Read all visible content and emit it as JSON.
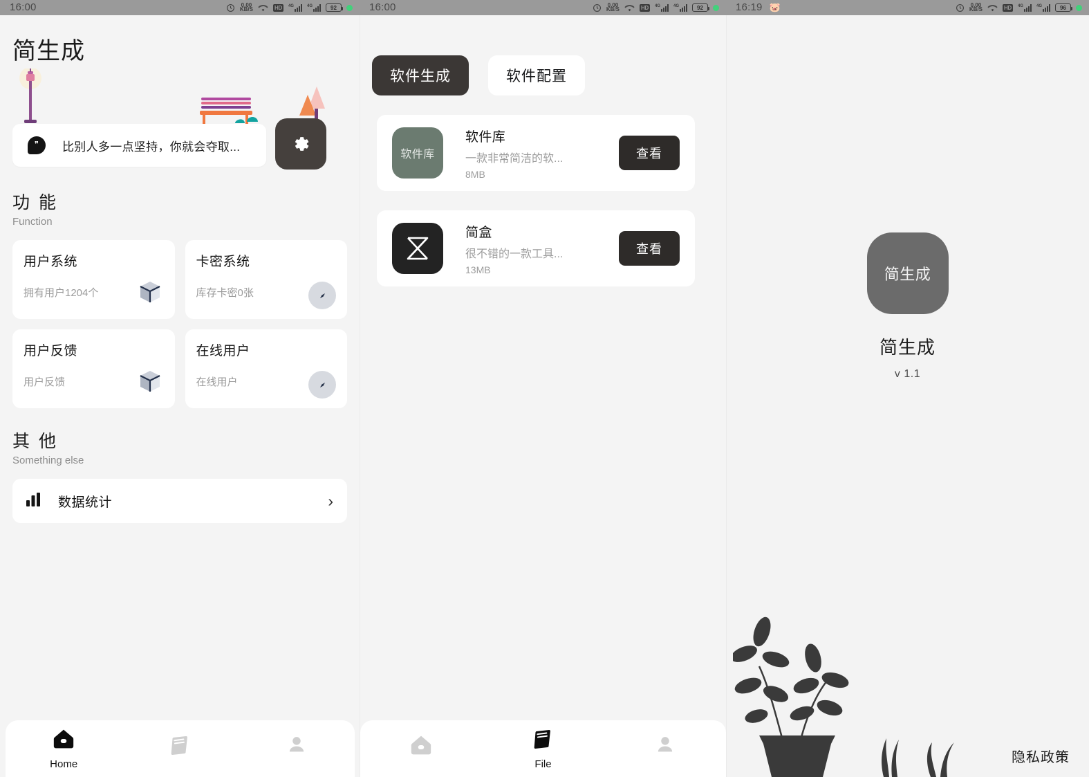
{
  "statusbars": [
    {
      "time": "16:00",
      "emoji": "",
      "net": "0.00",
      "net_unit": "KB/S",
      "hd": "HD",
      "g1": "4G",
      "g2": "4G",
      "battery": "92"
    },
    {
      "time": "16:00",
      "emoji": "",
      "net": "0.00",
      "net_unit": "KB/S",
      "hd": "HD",
      "g1": "4G",
      "g2": "4G",
      "battery": "92"
    },
    {
      "time": "16:19",
      "emoji": "🐷",
      "net": "0.00",
      "net_unit": "KB/S",
      "hd": "HD",
      "g1": "4G",
      "g2": "4G",
      "battery": "96"
    }
  ],
  "left": {
    "app_title": "简生成",
    "quote": "比别人多一点坚持，你就会夺取...",
    "settings_icon": "gear-icon",
    "sections": [
      {
        "zh": "功 能",
        "en": "Function"
      },
      {
        "zh": "其 他",
        "en": "Something else"
      }
    ],
    "function_cards": [
      {
        "title": "用户系统",
        "sub": "拥有用户1204个",
        "icon": "package-box-icon"
      },
      {
        "title": "卡密系统",
        "sub": "库存卡密0张",
        "icon": "compass-icon"
      },
      {
        "title": "用户反馈",
        "sub": "用户反馈",
        "icon": "package-box-icon"
      },
      {
        "title": "在线用户",
        "sub": "在线用户",
        "icon": "compass-icon"
      }
    ],
    "other_rows": [
      {
        "label": "数据统计",
        "icon": "bar-chart-icon",
        "chevron": "›"
      }
    ]
  },
  "mid": {
    "tabs": [
      {
        "label": "软件生成",
        "active": true
      },
      {
        "label": "软件配置",
        "active": false
      }
    ],
    "software": [
      {
        "icon_label": "软件库",
        "icon_color": "#6b7b70",
        "name": "软件库",
        "desc": "一款非常简洁的软...",
        "size": "8MB",
        "button": "查看"
      },
      {
        "icon_label": "",
        "icon_color": "#232323",
        "name": "简盒",
        "desc": "很不错的一款工具...",
        "size": "13MB",
        "button": "查看"
      }
    ]
  },
  "right": {
    "app_icon_label": "简生成",
    "app_name": "简生成",
    "version": "v 1.1",
    "privacy_link": "隐私政策"
  },
  "navbars": [
    {
      "items": [
        {
          "icon": "home-icon",
          "label": "Home",
          "active": true
        },
        {
          "icon": "book-icon",
          "label": "",
          "active": false
        },
        {
          "icon": "person-icon",
          "label": "",
          "active": false
        }
      ]
    },
    {
      "items": [
        {
          "icon": "home-icon",
          "label": "",
          "active": false
        },
        {
          "icon": "book-icon",
          "label": "File",
          "active": true
        },
        {
          "icon": "person-icon",
          "label": "",
          "active": false
        }
      ]
    }
  ],
  "colors": {
    "background": "#f4f4f4",
    "card": "#ffffff",
    "accent_dark": "#2e2b29",
    "statusbar": "#9a9a9a",
    "muted_text": "#9b9b9b"
  }
}
